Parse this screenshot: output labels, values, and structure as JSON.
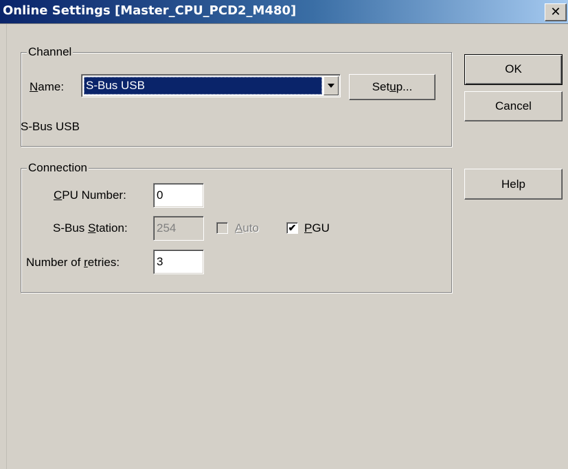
{
  "window": {
    "title": "Online Settings [Master_CPU_PCD2_M480]",
    "close_symbol": "✕"
  },
  "channel": {
    "legend": "Channel",
    "name_label_u": "N",
    "name_label_rest": "ame:",
    "name_value": "S-Bus USB",
    "setup_pre": "Set",
    "setup_u": "u",
    "setup_post": "p...",
    "description": "S-Bus USB"
  },
  "connection": {
    "legend": "Connection",
    "cpu_label_u": "C",
    "cpu_label_rest": "PU Number:",
    "cpu_value": "0",
    "station_label_pre": "S-Bus ",
    "station_label_u": "S",
    "station_label_post": "tation:",
    "station_value": "254",
    "auto_u": "A",
    "auto_rest": "uto",
    "auto_checked": false,
    "pgu_u": "P",
    "pgu_rest": "GU",
    "pgu_checked": true,
    "retries_label_pre": "Number of ",
    "retries_label_u": "r",
    "retries_label_post": "etries:",
    "retries_value": "3"
  },
  "buttons": {
    "ok": "OK",
    "cancel": "Cancel",
    "help": "Help"
  },
  "check_symbol": "✔"
}
